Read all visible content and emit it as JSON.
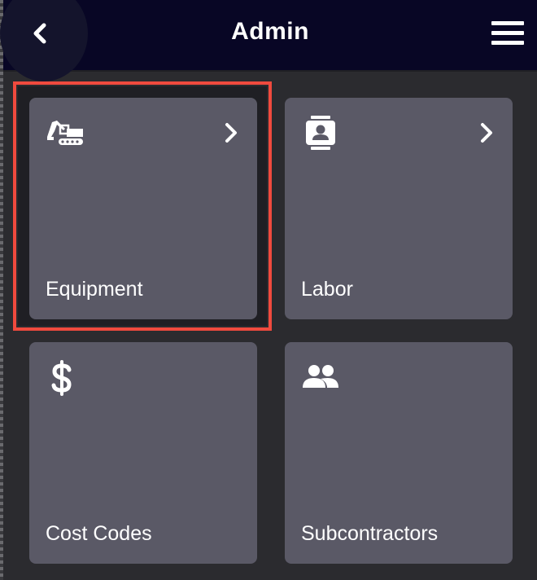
{
  "header": {
    "title": "Admin",
    "back_icon": "chevron-left-icon",
    "menu_icon": "hamburger-menu-icon"
  },
  "tiles": [
    {
      "label": "Equipment",
      "icon": "excavator-icon",
      "has_chevron": true,
      "highlighted": true
    },
    {
      "label": "Labor",
      "icon": "contact-card-icon",
      "has_chevron": true,
      "highlighted": false
    },
    {
      "label": "Cost Codes",
      "icon": "dollar-icon",
      "has_chevron": false,
      "highlighted": false
    },
    {
      "label": "Subcontractors",
      "icon": "people-icon",
      "has_chevron": false,
      "highlighted": false
    }
  ],
  "colors": {
    "header_bg": "#080625",
    "page_bg": "#2b2b2f",
    "tile_bg": "#5a5966",
    "highlight": "#f04a3e",
    "text": "#ffffff"
  }
}
